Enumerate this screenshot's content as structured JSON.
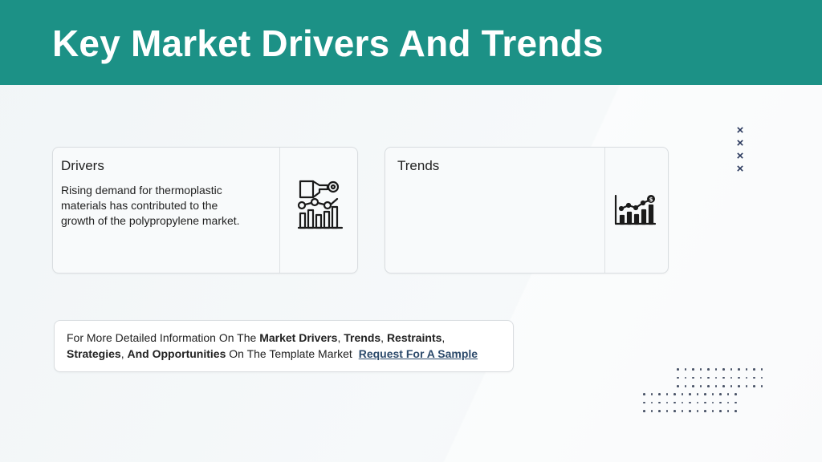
{
  "header": {
    "title": "Key Market Drivers And Trends",
    "background": "#1c9186"
  },
  "drivers_card": {
    "heading": "Drivers",
    "body": "Rising demand for thermoplastic materials has contributed to the growth of the polypropylene market.",
    "icon": "hand-gear-chart-icon"
  },
  "trends_card": {
    "heading": "Trends",
    "body": "",
    "icon": "bar-chart-dollar-icon"
  },
  "decor": {
    "x_marks": [
      "×",
      "×",
      "×",
      "×"
    ],
    "x_color": "#2b3a5e"
  },
  "info": {
    "t1": "For More Detailed Information On The ",
    "b1": "Market Drivers",
    "t2": ", ",
    "b2": "Trends",
    "t3": ", ",
    "b3": "Restraints",
    "t4": ", ",
    "b4": "Strategies",
    "t5": ", ",
    "b5": "And Opportunities",
    "t6": " On The Template Market",
    "link": "Request For A Sample",
    "link_color": "#2c4a6b"
  }
}
